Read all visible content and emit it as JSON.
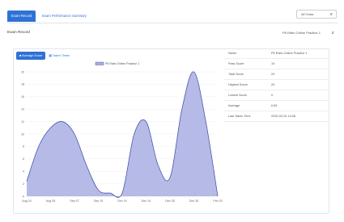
{
  "tabs": [
    {
      "label": "Exam Record",
      "active": true
    },
    {
      "label": "Exam Performance Summary",
      "active": false
    }
  ],
  "class_select": {
    "value": "All Class"
  },
  "section": {
    "title": "Exam Record"
  },
  "exam_select": {
    "value": "P6 Ratio Online Practice 1"
  },
  "toggle": {
    "average_score": "Average Score",
    "taken_times": "Taken Times"
  },
  "info": [
    {
      "key": "Name",
      "value": "P6 Ratio Online Practice 1"
    },
    {
      "key": "Pass Score",
      "value": "10"
    },
    {
      "key": "Total Score",
      "value": "20"
    },
    {
      "key": "Highest Score",
      "value": "20"
    },
    {
      "key": "Lowest Score",
      "value": "0"
    },
    {
      "key": "Average",
      "value": "6.59"
    },
    {
      "key": "Last Taken Time",
      "value": "2025-02-03 14:08"
    }
  ],
  "colors": {
    "accent": "#2f72d6",
    "series_fill": "#a9aee2",
    "series_line": "#3b46a7"
  },
  "chart_data": {
    "type": "area",
    "legend": [
      "P6 Ratio Online Practice 1"
    ],
    "x_ticks": [
      "Aug 24",
      "Aug 26",
      "Sep 07",
      "Sep 19",
      "Dec 19",
      "Dec 14",
      "Dec 28",
      "Dec 30",
      "Feb 03"
    ],
    "y_ticks": [
      0,
      2,
      4,
      6,
      8,
      10,
      12,
      14,
      16,
      18,
      20
    ],
    "ylim": [
      0,
      20
    ],
    "series": [
      {
        "name": "P6 Ratio Online Practice 1",
        "x": [
          0,
          0.5,
          1,
          1.5,
          2,
          2.5,
          3,
          3.5,
          4,
          4.5,
          5,
          5.5,
          6,
          6.5,
          7,
          7.5,
          8
        ],
        "values": [
          2.4,
          8,
          11,
          12,
          10,
          5,
          1,
          0.5,
          0.5,
          10,
          12,
          5,
          3,
          14,
          20,
          12,
          0
        ]
      }
    ]
  }
}
